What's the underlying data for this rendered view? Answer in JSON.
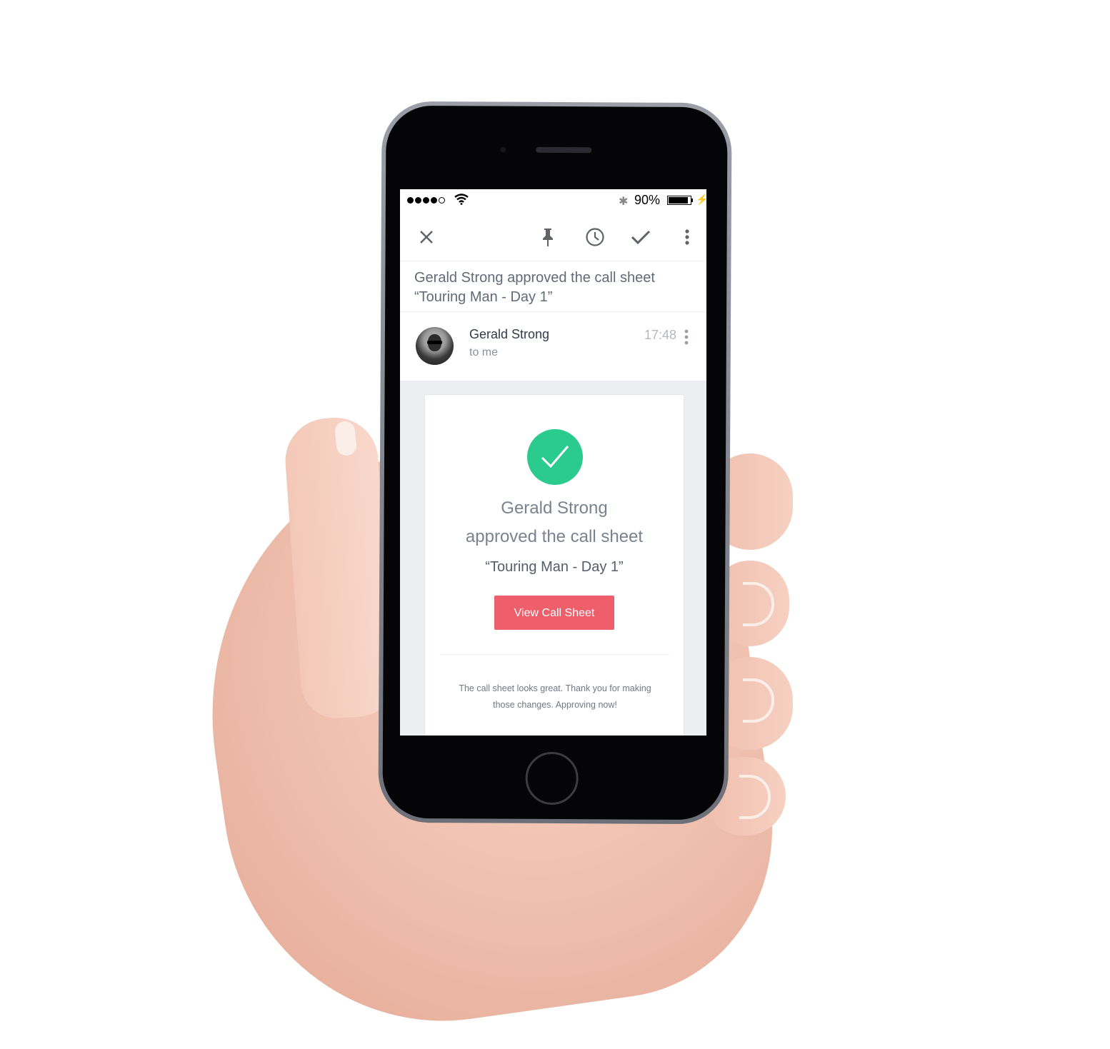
{
  "status_bar": {
    "signal_bars_filled": 4,
    "signal_bars_total": 5,
    "wifi_icon": "wifi-icon",
    "bluetooth_icon": "bluetooth-icon",
    "battery_percent_text": "90%",
    "battery_level": 0.9,
    "charging_icon": "bolt-icon"
  },
  "toolbar": {
    "close_icon": "close-icon",
    "pin_icon": "pin-icon",
    "snooze_icon": "clock-icon",
    "done_icon": "check-icon",
    "more_icon": "more-vertical-icon"
  },
  "email": {
    "subject_line1": "Gerald Strong approved the call sheet",
    "subject_line2": "“Touring Man - Day 1”",
    "sender_name": "Gerald Strong",
    "recipient": "to me",
    "time": "17:48"
  },
  "card": {
    "status_icon": "check-circle-icon",
    "status_color": "#2bcb8f",
    "line1": "Gerald Strong",
    "line2": "approved the call sheet",
    "line3": "“Touring Man - Day 1”",
    "button_label": "View Call Sheet",
    "button_color": "#ef5f6b",
    "note": "The call sheet looks great. Thank you for making those changes. Approving now!"
  }
}
